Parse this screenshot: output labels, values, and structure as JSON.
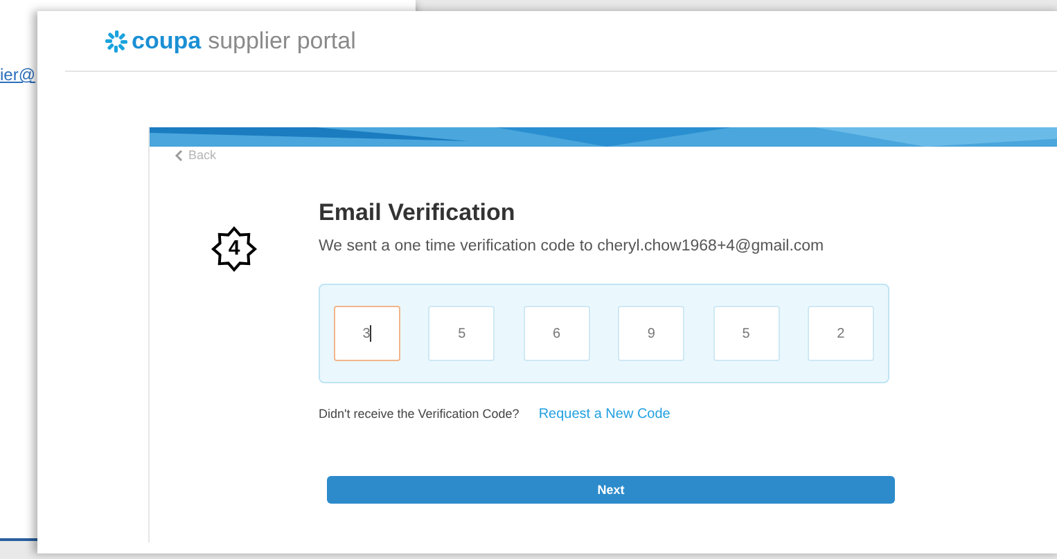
{
  "background_window": {
    "link_text": "ier@"
  },
  "header": {
    "brand": "coupa",
    "product": "supplier portal"
  },
  "card": {
    "back_label": "Back",
    "step_badge": "4",
    "title": "Email Verification",
    "message": "We sent a one time verification code to cheryl.chow1968+4@gmail.com",
    "code_digits": [
      {
        "value": "3",
        "focused": true
      },
      {
        "value": "5",
        "focused": false
      },
      {
        "value": "6",
        "focused": false
      },
      {
        "value": "9",
        "focused": false
      },
      {
        "value": "5",
        "focused": false
      },
      {
        "value": "2",
        "focused": false
      }
    ],
    "resend_prompt": "Didn't receive the Verification Code?",
    "resend_link": "Request a New Code",
    "next_button": "Next"
  }
}
